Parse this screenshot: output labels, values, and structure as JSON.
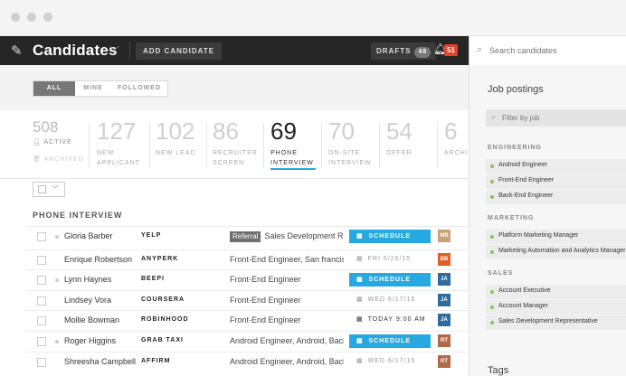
{
  "topbar": {
    "title": "Candidates",
    "add_label": "ADD CANDIDATE",
    "drafts_label": "DRAFTS",
    "drafts_count": "48",
    "notif_count": "51",
    "search_placeholder": "Search candidates"
  },
  "filters": [
    "ALL",
    "MINE",
    "FOLLOWED"
  ],
  "stages": [
    {
      "num": "508",
      "label1": "ACTIVE",
      "label2": "ARCHIVED"
    },
    {
      "num": "127",
      "label1": "NEW",
      "label2": "APPLICANT"
    },
    {
      "num": "102",
      "label1": "NEW LEAD",
      "label2": ""
    },
    {
      "num": "86",
      "label1": "RECRUITER",
      "label2": "SCREEN"
    },
    {
      "num": "69",
      "label1": "PHONE",
      "label2": "INTERVIEW"
    },
    {
      "num": "70",
      "label1": "ON-SITE",
      "label2": "INTERVIEW"
    },
    {
      "num": "54",
      "label1": "OFFER",
      "label2": ""
    },
    {
      "num": "6",
      "label1": "ARCHIV",
      "label2": ""
    }
  ],
  "section_title": "PHONE INTERVIEW",
  "rows": [
    {
      "name": "Gloria Barber",
      "company": "YELP",
      "referral": "Referral",
      "job": "Sales Development Repr",
      "action": "SCHEDULE",
      "avatar": "MB",
      "avatar_color": "#c9a27a"
    },
    {
      "name": "Enrique Robertson",
      "company": "ANYPERK",
      "referral": "",
      "job": "Front-End Engineer, San francisco,",
      "date": "FRI 6/26/15",
      "avatar": "BB",
      "avatar_color": "#e0602a"
    },
    {
      "name": "Lynn Haynes",
      "company": "BEEPI",
      "referral": "",
      "job": "Front-End Engineer",
      "action": "SCHEDULE",
      "avatar": "JA",
      "avatar_color": "#2e6c9e"
    },
    {
      "name": "Lindsey Vora",
      "company": "COURSERA",
      "referral": "",
      "job": "Front-End Engineer",
      "date": "WED 6/17/15",
      "avatar": "JA",
      "avatar_color": "#2e6c9e"
    },
    {
      "name": "Mollie Bowman",
      "company": "ROBINHOOD",
      "referral": "",
      "job": "Front-End Engineer",
      "date": "TODAY 9:00 AM",
      "avatar": "JA",
      "avatar_color": "#2e6c9e"
    },
    {
      "name": "Roger Higgins",
      "company": "GRAB TAXI",
      "referral": "",
      "job": "Android Engineer, Android, Back-I",
      "action": "SCHEDULE",
      "avatar": "RT",
      "avatar_color": "#b06a4a"
    },
    {
      "name": "Shreesha Campbell",
      "company": "AFFIRM",
      "referral": "",
      "job": "Android Engineer, Android, Back-I",
      "date": "WED 6/17/15",
      "avatar": "RT",
      "avatar_color": "#b06a4a"
    }
  ],
  "side": {
    "title": "Job postings",
    "filter_placeholder": "Filter by job",
    "groups": [
      {
        "name": "ENGINEERING",
        "items": [
          "Android Engineer",
          "Front-End Engineer",
          "Back-End Engineer"
        ]
      },
      {
        "name": "MARKETING",
        "items": [
          "Platform Marketing Manager",
          "Marketing Automation and Analytics Manager"
        ]
      },
      {
        "name": "SALES",
        "items": [
          "Account Executive",
          "Account Manager",
          "Sales Development Representative"
        ]
      }
    ],
    "tags_title": "Tags"
  }
}
